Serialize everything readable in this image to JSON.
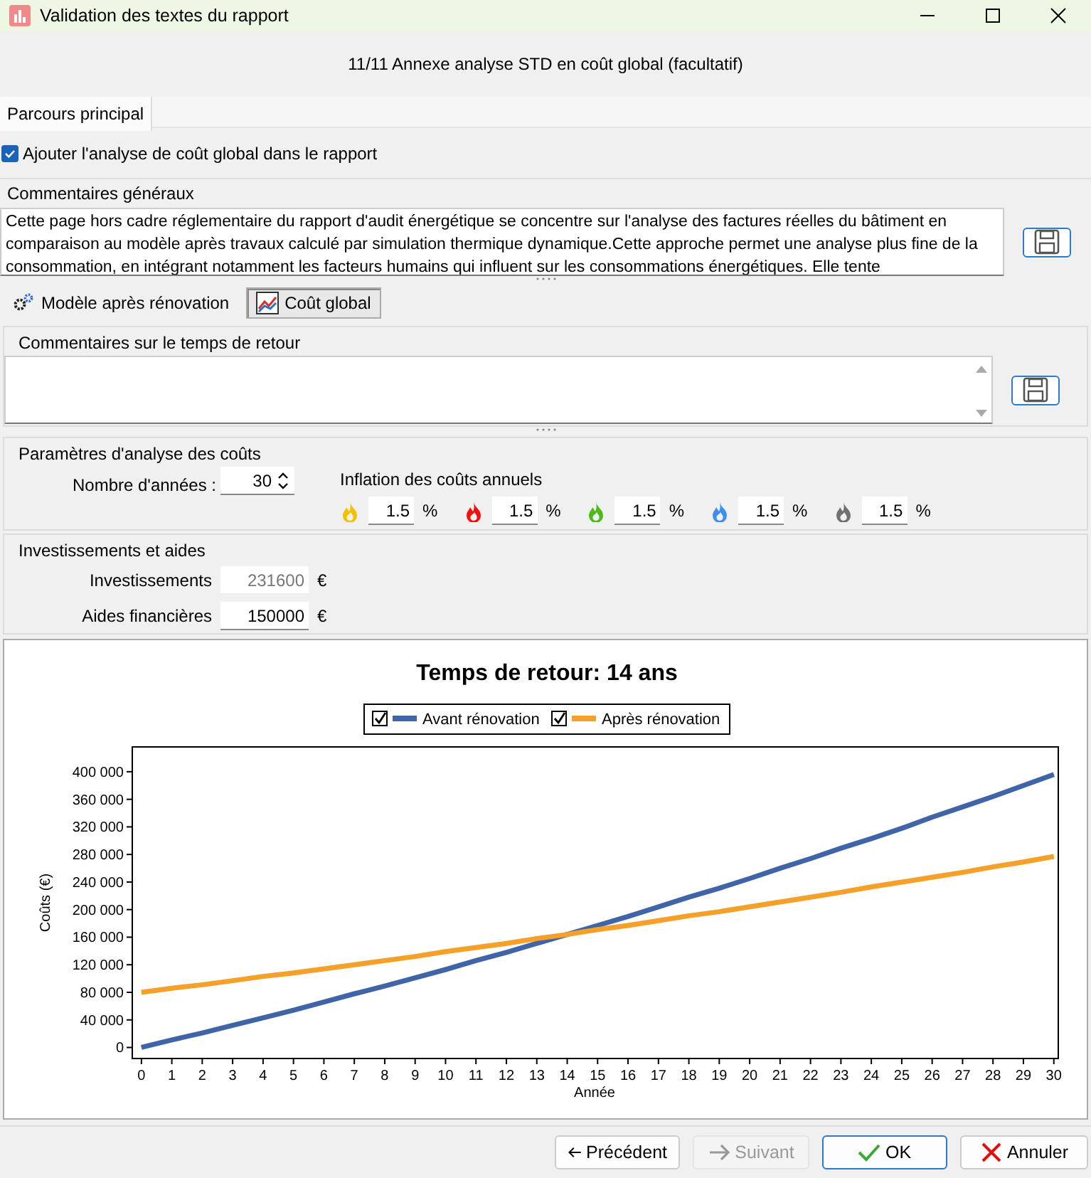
{
  "window": {
    "title": "Validation des textes du rapport"
  },
  "header": "11/11 Annexe analyse STD en coût global (facultatif)",
  "main_tabs": [
    {
      "label": "Parcours principal",
      "selected": true
    }
  ],
  "include_checkbox": {
    "label": "Ajouter l'analyse de coût global dans le rapport",
    "checked": true
  },
  "general_comments": {
    "title": "Commentaires généraux",
    "text": "Cette page hors cadre réglementaire du rapport d'audit énergétique se concentre sur l'analyse des factures réelles du bâtiment en comparaison au modèle après travaux calculé par simulation thermique dynamique.Cette approche permet une analyse plus fine de la consommation, en intégrant notamment les facteurs humains qui influent sur les consommations énergétiques. Elle tente"
  },
  "sub_tabs": [
    {
      "label": "Modèle après rénovation",
      "selected": false,
      "kind": "gears"
    },
    {
      "label": "Coût global",
      "selected": true,
      "kind": "chart"
    }
  ],
  "return_comments": {
    "title": "Commentaires sur le temps de retour"
  },
  "cost_params": {
    "title": "Paramètres d'analyse des coûts",
    "years_label": "Nombre d'années :",
    "years": "30",
    "inflation_label": "Inflation des coûts annuels",
    "inflation": [
      {
        "color": "#f2c200",
        "value": "1.5",
        "unit": "%"
      },
      {
        "color": "#f01010",
        "value": "1.5",
        "unit": "%"
      },
      {
        "color": "#4cbb17",
        "value": "1.5",
        "unit": "%"
      },
      {
        "color": "#3c8ef0",
        "value": "1.5",
        "unit": "%"
      },
      {
        "color": "#707070",
        "value": "1.5",
        "unit": "%"
      }
    ]
  },
  "investments": {
    "title": "Investissements et aides",
    "rows": [
      {
        "label": "Investissements",
        "value": "231600",
        "unit": "€",
        "disabled": true
      },
      {
        "label": "Aides financières",
        "value": "150000",
        "unit": "€",
        "disabled": false
      }
    ]
  },
  "chart": {
    "legend_checked": [
      true,
      true
    ],
    "chart_data": {
      "type": "line",
      "title": "Temps de retour: 14 ans",
      "xlabel": "Année",
      "ylabel": "Coûts (€)",
      "legend": "top",
      "x": [
        0,
        1,
        2,
        3,
        4,
        5,
        6,
        7,
        8,
        9,
        10,
        11,
        12,
        13,
        14,
        15,
        16,
        17,
        18,
        19,
        20,
        21,
        22,
        23,
        24,
        25,
        26,
        27,
        28,
        29,
        30
      ],
      "series": [
        {
          "name": "Avant rénovation",
          "color": "#4064a8",
          "values": [
            0,
            11000,
            21000,
            32000,
            43000,
            54000,
            66000,
            78000,
            89000,
            101000,
            113000,
            126000,
            138000,
            151000,
            164000,
            177000,
            190000,
            204000,
            218000,
            231000,
            245000,
            260000,
            274000,
            289000,
            303000,
            318000,
            334000,
            349000,
            364000,
            380000,
            396000
          ]
        },
        {
          "name": "Après rénovation",
          "color": "#f5a028",
          "values": [
            80000,
            86000,
            91000,
            97000,
            103000,
            108000,
            114000,
            120000,
            126000,
            132000,
            139000,
            145000,
            151000,
            158000,
            164000,
            171000,
            177000,
            184000,
            191000,
            197000,
            204000,
            211000,
            218000,
            225000,
            233000,
            240000,
            247000,
            254000,
            262000,
            269000,
            277000
          ]
        }
      ],
      "xlim": [
        -0.3,
        30.1
      ],
      "ylim": [
        -16000,
        436000
      ],
      "xticks": [
        0,
        1,
        2,
        3,
        4,
        5,
        6,
        7,
        8,
        9,
        10,
        11,
        12,
        13,
        14,
        15,
        16,
        17,
        18,
        19,
        20,
        21,
        22,
        23,
        24,
        25,
        26,
        27,
        28,
        29,
        30
      ],
      "yticks": [
        {
          "value": 0,
          "label": "0"
        },
        {
          "value": 40000,
          "label": "40 000"
        },
        {
          "value": 80000,
          "label": "80 000"
        },
        {
          "value": 120000,
          "label": "120 000"
        },
        {
          "value": 160000,
          "label": "160 000"
        },
        {
          "value": 200000,
          "label": "200 000"
        },
        {
          "value": 240000,
          "label": "240 000"
        },
        {
          "value": 280000,
          "label": "280 000"
        },
        {
          "value": 320000,
          "label": "320 000"
        },
        {
          "value": 360000,
          "label": "360 000"
        },
        {
          "value": 400000,
          "label": "400 000"
        }
      ]
    }
  },
  "buttons": [
    {
      "label": "Précédent",
      "kind": "prev",
      "disabled": false,
      "selected": false
    },
    {
      "label": "Suivant",
      "kind": "next",
      "disabled": true,
      "selected": false
    },
    {
      "label": "OK",
      "kind": "ok",
      "disabled": false,
      "selected": true
    },
    {
      "label": "Annuler",
      "kind": "cancel",
      "disabled": false,
      "selected": false
    }
  ]
}
